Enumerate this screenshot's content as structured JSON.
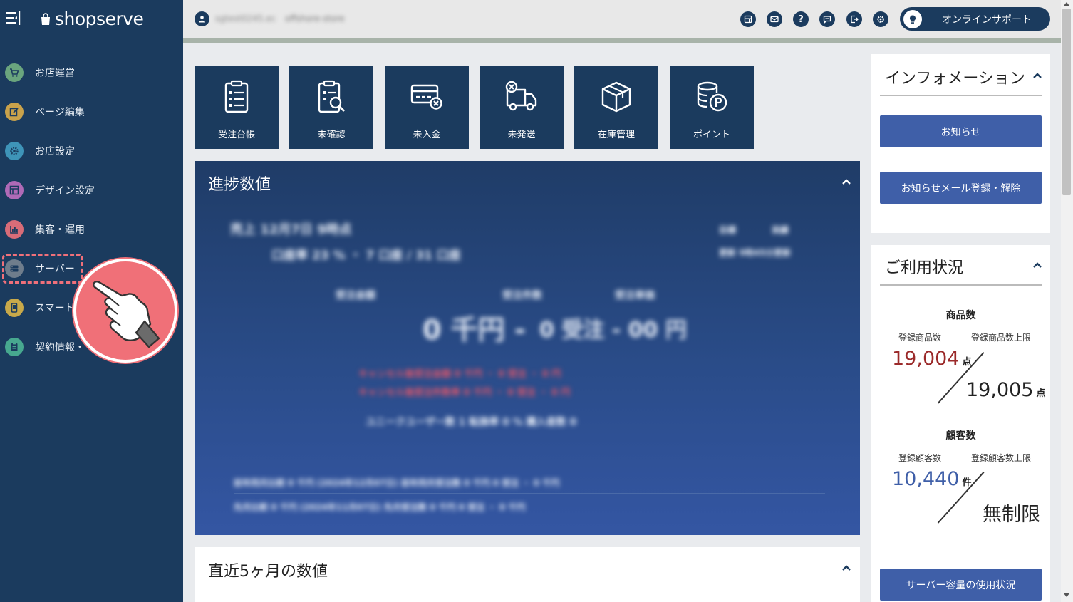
{
  "brand": {
    "name": "shopserve"
  },
  "sidebar": {
    "items": [
      {
        "label": "お店運営",
        "icon": "cart-icon",
        "color": "#6aa57e"
      },
      {
        "label": "ページ編集",
        "icon": "edit-icon",
        "color": "#c9a24b"
      },
      {
        "label": "お店設定",
        "icon": "gear-icon",
        "color": "#3e94b8"
      },
      {
        "label": "デザイン設定",
        "icon": "layout-icon",
        "color": "#b06ab7"
      },
      {
        "label": "集客・運用",
        "icon": "bar-chart-icon",
        "color": "#d86c78"
      },
      {
        "label": "サーバー",
        "icon": "server-icon",
        "color": "#6f7d8c"
      },
      {
        "label": "スマート",
        "icon": "phone-icon",
        "color": "#c8a94a"
      },
      {
        "label": "契約情報・",
        "icon": "clipboard-icon",
        "color": "#47a88f"
      }
    ]
  },
  "header": {
    "user_name": "sgtest0245.ec",
    "shop_name": "offshore-store",
    "support_label": "オンラインサポート",
    "help_glyph": "?"
  },
  "tiles": [
    {
      "label": "受注台帳",
      "icon": "clipboard-list-icon"
    },
    {
      "label": "未確認",
      "icon": "clipboard-search-icon"
    },
    {
      "label": "未入金",
      "icon": "card-cancel-icon"
    },
    {
      "label": "未発送",
      "icon": "truck-cancel-icon"
    },
    {
      "label": "在庫管理",
      "icon": "box-icon"
    },
    {
      "label": "ポイント",
      "icon": "coins-point-icon"
    }
  ],
  "progress": {
    "title": "進捗数値",
    "blurred": {
      "l1": "売上 12月7日 9時点",
      "l2": "口座率 23 % ・ 7 口座 / 31 口座",
      "legend1": "目標",
      "legend2": "実績",
      "updated": "更新 9時45分更新",
      "h1": "受注金額",
      "h2": "受注件数",
      "h3": "受注単価",
      "v1": "0 千円 -",
      "v2": "0 受注 - 00 円",
      "c1": "キャンセル後受注金額 0 千円 ・ 0 受注 ・ 0 円",
      "c2": "キャンセル後受注件数率 0 千円 ・ 0 受注 ・ 0 円",
      "u1": "ユニークユーザー数 1 転換率 0 % 購入者数 0",
      "r1": "前年同月比較 0 千円 (2024年12月07日) 前年同月受注数 0 千円 0 受注 ・ 0 千円",
      "r2": "先月比較 0 千円 (2024年11月07日) 先月受注数 0 千円 0 受注 ・ 0 千円"
    }
  },
  "recent": {
    "title": "直近5ヶ月の数値"
  },
  "info": {
    "title": "インフォメーション",
    "btn_news": "お知らせ",
    "btn_mail": "お知らせメール登録・解除"
  },
  "usage": {
    "title": "ご利用状況",
    "products": {
      "heading": "商品数",
      "left_label": "登録商品数",
      "right_label": "登録商品数上限",
      "count": "19,004",
      "unit": "点",
      "limit": "19,005",
      "limit_unit": "点"
    },
    "customers": {
      "heading": "顧客数",
      "left_label": "登録顧客数",
      "right_label": "登録顧客数上限",
      "count": "10,440",
      "unit": "件",
      "limit": "無制限"
    },
    "server_btn": "サーバー容量の使用状況"
  },
  "colors": {
    "sidebar": "#1b3b5e",
    "accent_button": "#3f5fa8",
    "highlight": "#f07078",
    "product_count": "#9b2a2a",
    "customer_count": "#3f5fa8"
  }
}
